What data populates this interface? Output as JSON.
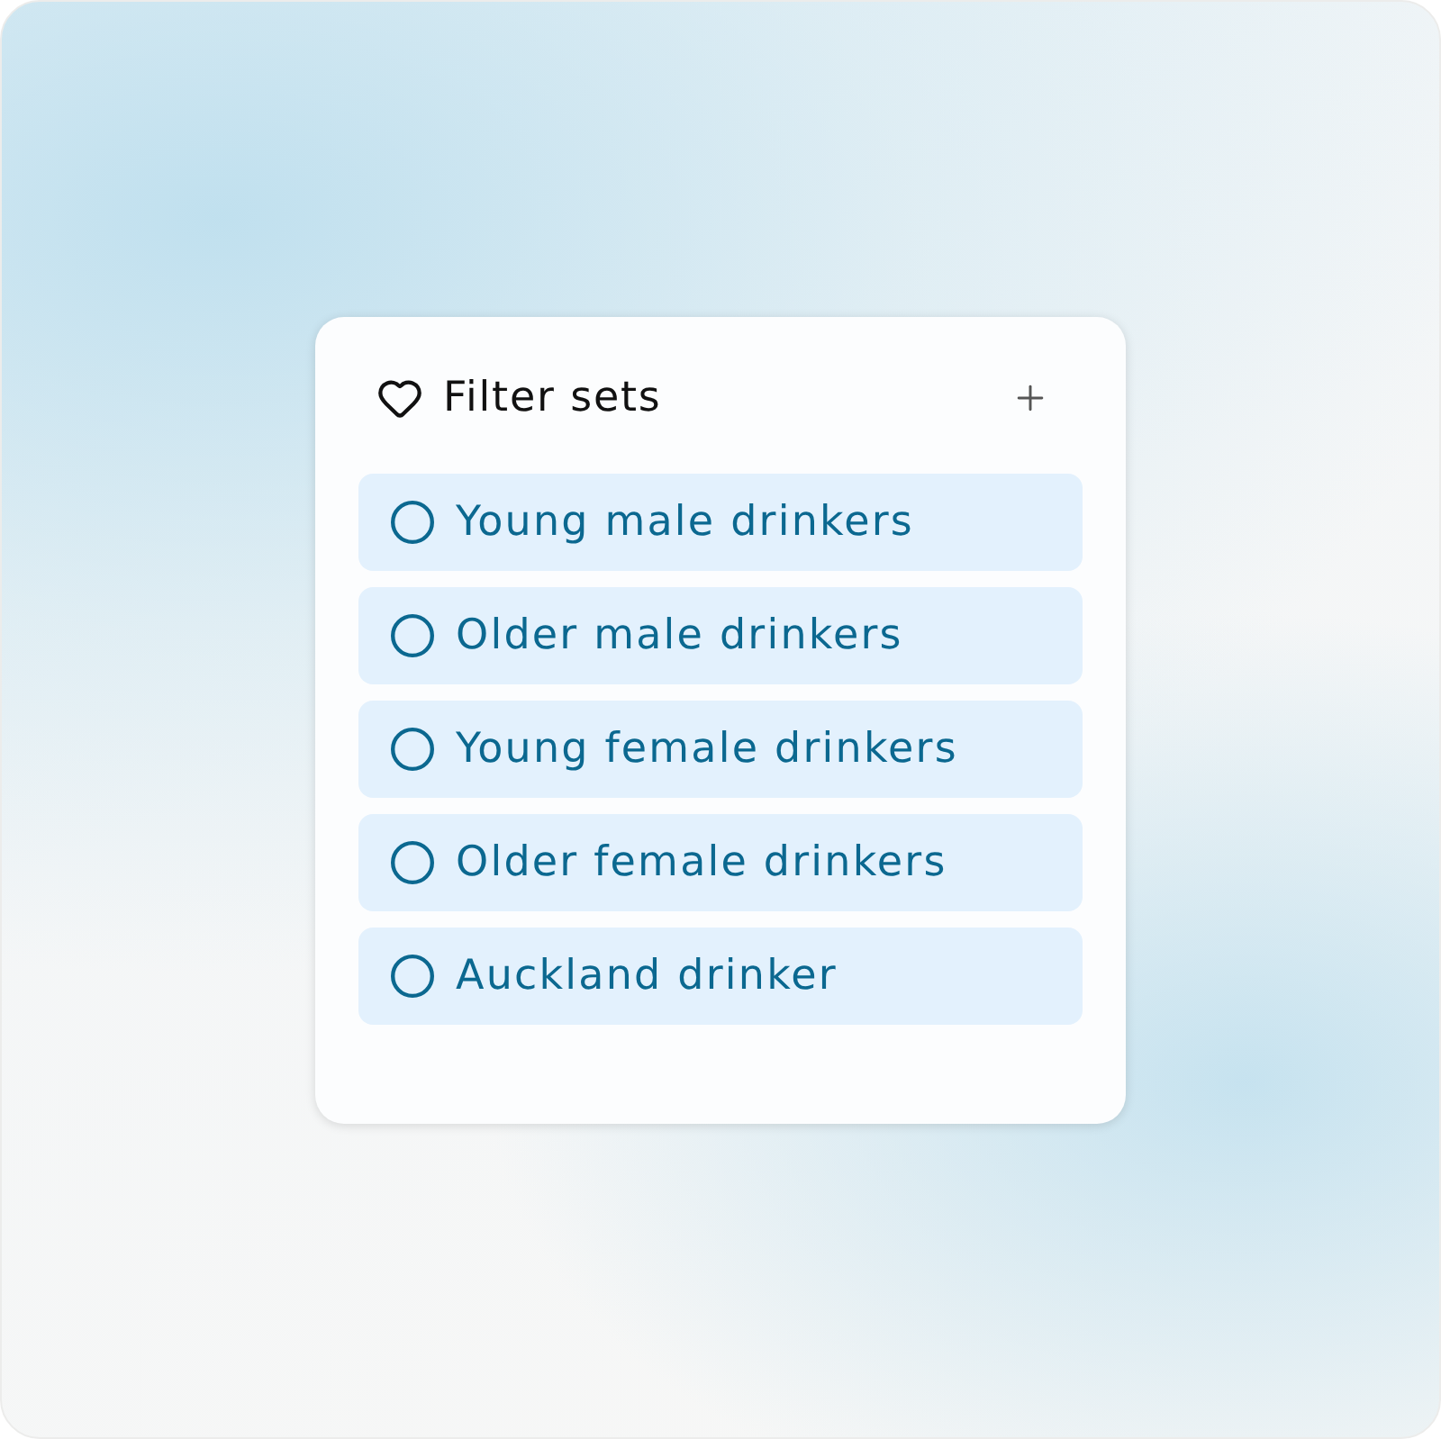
{
  "panel": {
    "title": "Filter sets"
  },
  "filter_sets": [
    {
      "label": "Young male drinkers",
      "selected": false
    },
    {
      "label": "Older male drinkers",
      "selected": false
    },
    {
      "label": "Young female drinkers",
      "selected": false
    },
    {
      "label": "Older female drinkers",
      "selected": false
    },
    {
      "label": "Auckland drinker",
      "selected": false
    }
  ]
}
